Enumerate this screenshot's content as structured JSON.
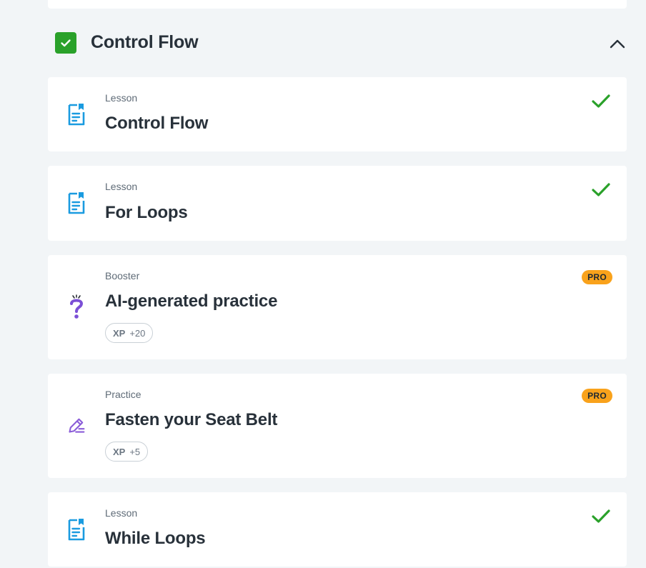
{
  "section": {
    "title": "Control Flow",
    "completed": true,
    "expanded": true
  },
  "colors": {
    "success_green": "#2aa12a",
    "lesson_blue": "#1a9be0",
    "booster_purple": "#7b4fd6",
    "practice_purple": "#8a5cd8",
    "pro_orange": "#f9a21b",
    "background": "#f2f5f7"
  },
  "items": [
    {
      "type_label": "Lesson",
      "title": "Control Flow",
      "icon": "lesson-document-icon",
      "status": "completed"
    },
    {
      "type_label": "Lesson",
      "title": "For Loops",
      "icon": "lesson-document-icon",
      "status": "completed"
    },
    {
      "type_label": "Booster",
      "title": "AI-generated practice",
      "icon": "question-mark-icon",
      "badge": "PRO",
      "xp_label": "XP",
      "xp_value": "+20"
    },
    {
      "type_label": "Practice",
      "title": "Fasten your Seat Belt",
      "icon": "pencil-edit-icon",
      "badge": "PRO",
      "xp_label": "XP",
      "xp_value": "+5"
    },
    {
      "type_label": "Lesson",
      "title": "While Loops",
      "icon": "lesson-document-icon",
      "status": "completed"
    }
  ]
}
